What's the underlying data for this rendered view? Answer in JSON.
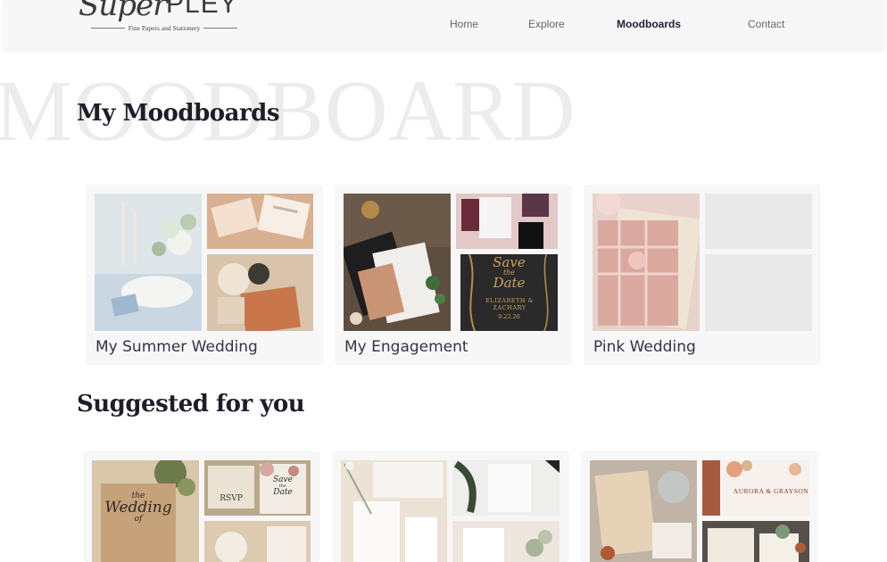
{
  "header": {
    "logo": {
      "script": "Super",
      "caps": "PLEY",
      "tagline": "Fine Papers and Stationery"
    },
    "nav": [
      {
        "label": "Home",
        "active": false
      },
      {
        "label": "Explore",
        "active": false
      },
      {
        "label": "Moodboards",
        "active": true
      },
      {
        "label": "Contact",
        "active": false
      }
    ]
  },
  "hero": {
    "watermark": "MOODBOARD"
  },
  "my_moodboards": {
    "title": "My Moodboards",
    "boards": [
      {
        "name": "My Summer Wedding"
      },
      {
        "name": "My Engagement"
      },
      {
        "name": "Pink Wedding"
      }
    ]
  },
  "engagement_card_text": {
    "save": "Save",
    "the": "the",
    "date": "Date",
    "names": "ELIZABETH & ZACHARY",
    "date_value": "9.22.26"
  },
  "suggested": {
    "title": "Suggested for you",
    "rustic_text": {
      "the": "the",
      "wedding": "Wedding",
      "of": "of",
      "rsvp": "RSVP",
      "save": "Save",
      "the2": "the",
      "date": "Date"
    },
    "floral_text": {
      "names": "AURORA & GRAYSON"
    }
  },
  "colors": {
    "accent": "#20203a",
    "card_bg": "#f7f7f7",
    "header_bg": "#f7f7f7"
  }
}
